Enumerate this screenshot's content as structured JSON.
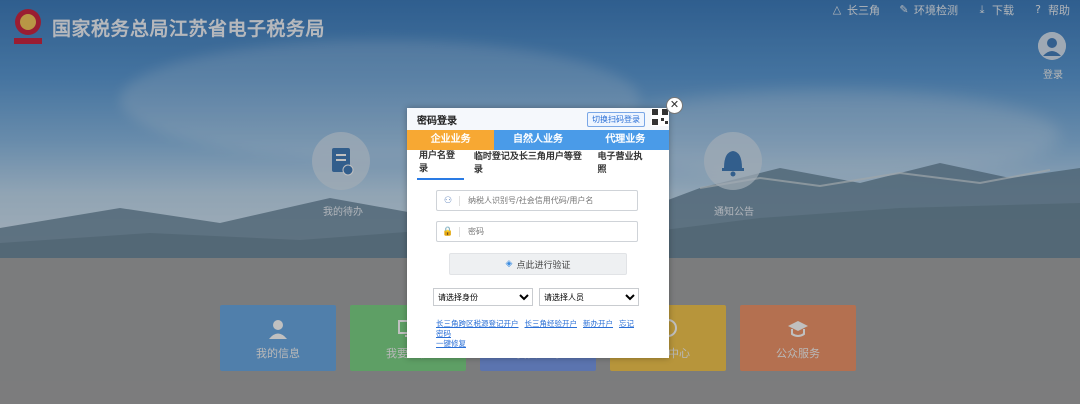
{
  "header": {
    "title": "国家税务总局江苏省电子税务局",
    "nav": [
      {
        "label": "长三角",
        "icon": "network-icon"
      },
      {
        "label": "环境检测",
        "icon": "tools-icon"
      },
      {
        "label": "下载",
        "icon": "download-icon"
      },
      {
        "label": "帮助",
        "icon": "help-icon"
      }
    ],
    "login_label": "登录"
  },
  "features": {
    "left_label": "我的待办",
    "right_label": "通知公告"
  },
  "tiles": [
    {
      "label": "我的信息",
      "color": "#5b9fe0"
    },
    {
      "label": "我要办税",
      "color": "#6fcf7a"
    },
    {
      "label": "我要查询",
      "color": "#6b8fe6"
    },
    {
      "label": "互动中心",
      "color": "#f2c03c"
    },
    {
      "label": "公众服务",
      "color": "#ee8a5a"
    }
  ],
  "dialog": {
    "title": "密码登录",
    "switch_label": "切换扫码登录",
    "tabs": [
      {
        "label": "企业业务",
        "color": "#f7a833"
      },
      {
        "label": "自然人业务",
        "color": "#4a9be8"
      },
      {
        "label": "代理业务",
        "color": "#4a9be8"
      }
    ],
    "subtabs": [
      "用户名登录",
      "临时登记及长三角用户等登录",
      "电子营业执照"
    ],
    "username_placeholder": "纳税人识别号/社会信用代码/用户名",
    "password_placeholder": "密码",
    "verify_label": "点此进行验证",
    "identity_select": "请选择身份",
    "person_select": "请选择人员",
    "links": [
      "长三角跨区税源登记开户",
      "长三角经验开户",
      "新办开户",
      "忘记密码",
      "一键修复"
    ]
  }
}
